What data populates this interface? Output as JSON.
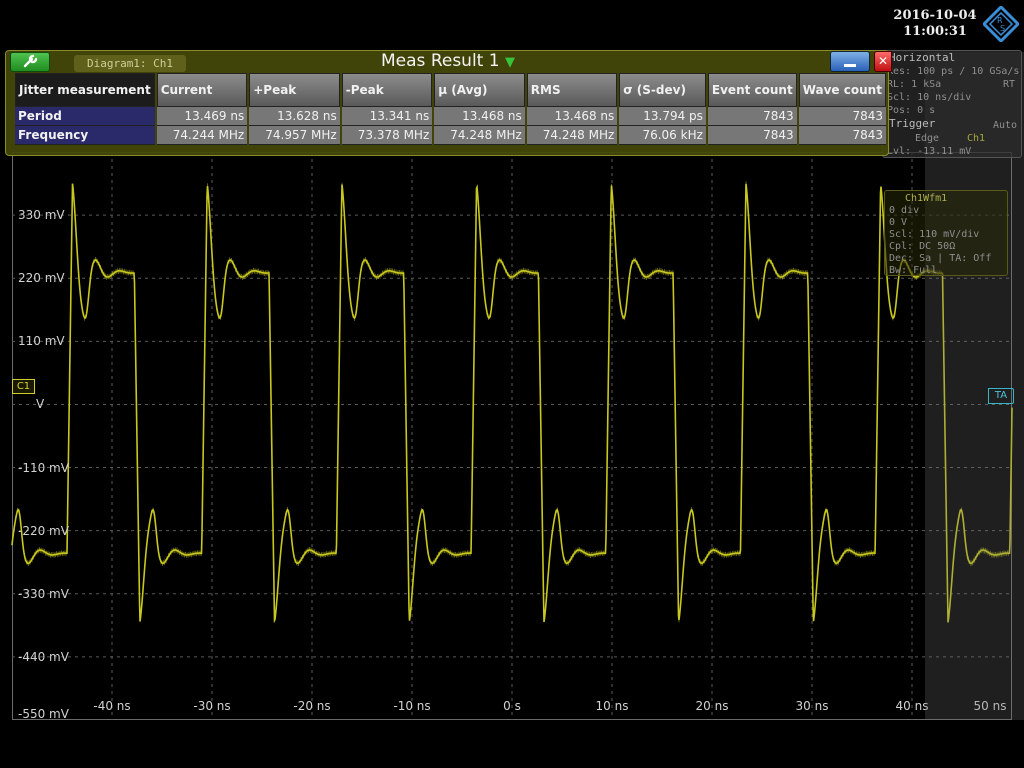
{
  "datetime": {
    "date": "2016-10-04",
    "time": "11:00:31"
  },
  "meas_window": {
    "title": "Meas Result 1",
    "diagram_tag": "Diagram1: Ch1",
    "columns": [
      "Jitter measurement",
      "Current",
      "+Peak",
      "-Peak",
      "μ (Avg)",
      "RMS",
      "σ (S-dev)",
      "Event count",
      "Wave count"
    ],
    "rows": [
      {
        "name": "Period",
        "values": [
          "13.469 ns",
          "13.628 ns",
          "13.341 ns",
          "13.468 ns",
          "13.468 ns",
          "13.794 ps",
          "7843",
          "7843"
        ]
      },
      {
        "name": "Frequency",
        "values": [
          "74.244 MHz",
          "74.957 MHz",
          "73.378 MHz",
          "74.248 MHz",
          "74.248 MHz",
          "76.06 kHz",
          "7843",
          "7843"
        ]
      }
    ]
  },
  "horizontal": {
    "title": "Horizontal",
    "res": "Res: 100 ps / 10 GSa/s",
    "rl": "RL: 1 kSa",
    "rt": "RT",
    "scl": "Scl: 10 ns/div",
    "pos": "Pos: 0 s",
    "trigger_title": "Trigger",
    "trigger_mode": "Auto",
    "trigger_edge": "Edge",
    "trigger_source": "Ch1",
    "trigger_level": "Lvl: -13.11 mV"
  },
  "wfm_panel": {
    "title": "Ch1Wfm1",
    "line1": "0 div",
    "line2": "0 V",
    "line3": "Scl: 110 mV/div",
    "line4": "Cpl: DC 50Ω",
    "line5": "Dec: Sa | TA: Off",
    "line6": "Bw: Full"
  },
  "markers": {
    "ch1": "C1",
    "ta": "TA"
  },
  "chart_data": {
    "type": "line",
    "title": "",
    "xlabel": "",
    "ylabel": "",
    "x_ticks": [
      "-40 ns",
      "-30 ns",
      "-20 ns",
      "-10 ns",
      "0 s",
      "10 ns",
      "20 ns",
      "30 ns",
      "40 ns",
      "50 ns"
    ],
    "y_ticks": [
      "330 mV",
      "220 mV",
      "110 mV",
      "V",
      "-110 mV",
      "-220 mV",
      "-330 mV",
      "-440 mV",
      "-550 mV"
    ],
    "x_range_ns": [
      -50,
      50
    ],
    "y_range_mV": [
      -550,
      440
    ],
    "grid": true,
    "trace_color": "#c8c81e",
    "period_ns": 13.469,
    "high_level_mV": 230,
    "low_level_mV": -260,
    "overshoot_peak_mV": 385,
    "undershoot_peak_mV": -380
  }
}
